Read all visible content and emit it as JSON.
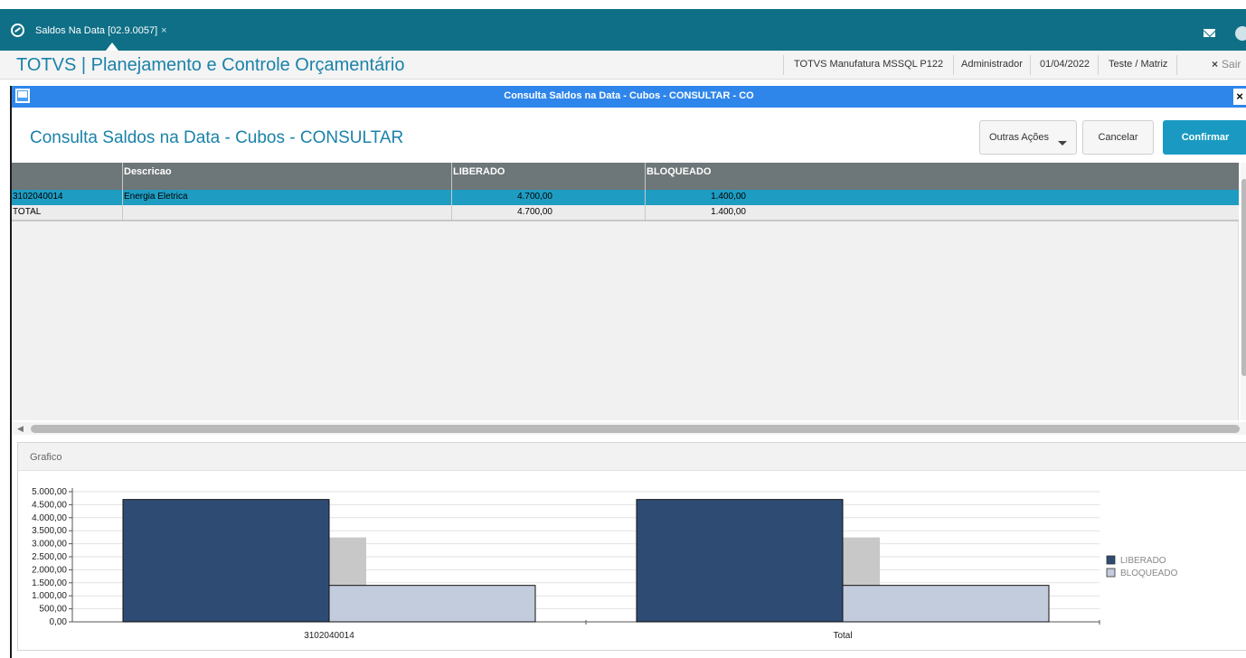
{
  "tab": {
    "label": "Saldos Na Data [02.9.0057]",
    "close": "×"
  },
  "header": {
    "app_title": "TOTVS | Planejamento e Controle Orçamentário",
    "environment": "TOTVS Manufatura MSSQL P122",
    "user": "Administrador",
    "date": "01/04/2022",
    "company": "Teste / Matriz",
    "exit_label": "Sair",
    "exit_icon": "×"
  },
  "dialog": {
    "title": "Consulta Saldos na Data - Cubos - CONSULTAR - CO",
    "close": "×",
    "form_title": "Consulta Saldos na Data - Cubos - CONSULTAR",
    "buttons": {
      "other": "Outras Ações",
      "cancel": "Cancelar",
      "confirm": "Confirmar"
    }
  },
  "grid": {
    "columns": [
      "",
      "Descricao",
      "LIBERADO",
      "BLOQUEADO"
    ],
    "rows": [
      {
        "code": "3102040014",
        "descricao": "Energia Eletrica",
        "liberado": "4.700,00",
        "bloqueado": "1.400,00"
      },
      {
        "code": "TOTAL",
        "descricao": "",
        "liberado": "4.700,00",
        "bloqueado": "1.400,00"
      }
    ]
  },
  "panel": {
    "title": "Grafico"
  },
  "colors": {
    "liberado": "#2e4b73",
    "bloqueado": "#c3ccdd",
    "shadow": "#c8c8c8",
    "accent": "#1a9ac2"
  },
  "chart_data": {
    "type": "bar",
    "categories": [
      "3102040014",
      "Total"
    ],
    "series": [
      {
        "name": "LIBERADO",
        "values": [
          4700,
          4700
        ]
      },
      {
        "name": "BLOQUEADO",
        "values": [
          1400,
          1400
        ]
      }
    ],
    "ylim": [
      0,
      5000
    ],
    "yticks": [
      "0,00",
      "500,00",
      "1.000,00",
      "1.500,00",
      "2.000,00",
      "2.500,00",
      "3.000,00",
      "3.500,00",
      "4.000,00",
      "4.500,00",
      "5.000,00"
    ],
    "grid": true,
    "legend": "right"
  }
}
